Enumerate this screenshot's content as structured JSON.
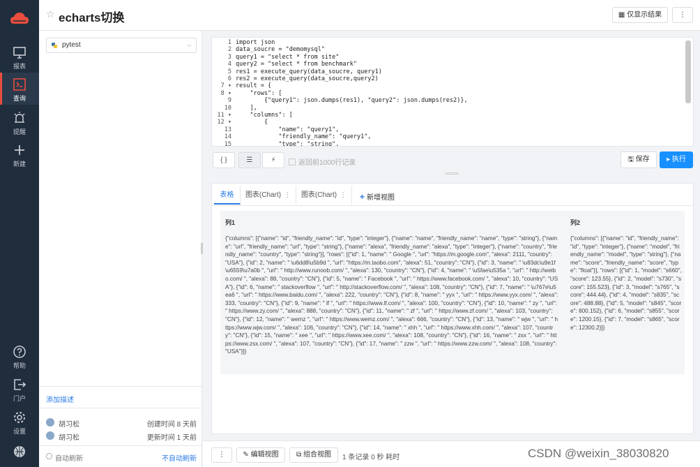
{
  "app": {
    "title": "echarts切换"
  },
  "nav": {
    "items": [
      {
        "label": "报表",
        "icon": "monitor-icon"
      },
      {
        "label": "查询",
        "icon": "terminal-icon"
      },
      {
        "label": "提醒",
        "icon": "alarm-icon"
      },
      {
        "label": "新建",
        "icon": "plus-icon"
      },
      {
        "label": "帮助",
        "icon": "help-icon"
      },
      {
        "label": "门户",
        "icon": "portal-icon"
      },
      {
        "label": "设置",
        "icon": "gear-icon"
      }
    ]
  },
  "header": {
    "results_only": "仅显示结果",
    "more": "⋮"
  },
  "datasource": {
    "selected": "pytest"
  },
  "left": {
    "add_desc": "添加描述",
    "created": {
      "user": "胡习松",
      "text": "创建时间 8 天前"
    },
    "updated": {
      "user": "胡习松",
      "text": "更新时间 1 天前"
    },
    "auto_refresh": "自动刷新",
    "no_auto_refresh": "不自动刷新"
  },
  "editor": {
    "lines": [
      {
        "n": "1",
        "code": "import json"
      },
      {
        "n": "2",
        "code": "data_soucre = \"demomysql\""
      },
      {
        "n": "3",
        "code": "query1 = \"select * from site\""
      },
      {
        "n": "4",
        "code": "query2 = \"select * from benchmark\""
      },
      {
        "n": "5",
        "code": "res1 = execute_query(data_soucre, query1)"
      },
      {
        "n": "6",
        "code": "res2 = execute_query(data_soucre,query2)"
      },
      {
        "n": "7 ▾",
        "code": "result = {"
      },
      {
        "n": "8 ▾",
        "code": "    \"rows\": ["
      },
      {
        "n": "9",
        "code": "        {\"query1\": json.dumps(res1), \"query2\": json.dumps(res2)},"
      },
      {
        "n": "10",
        "code": "    ],"
      },
      {
        "n": "11 ▾",
        "code": "    \"columns\": ["
      },
      {
        "n": "12 ▾",
        "code": "        {"
      },
      {
        "n": "13",
        "code": "            \"name\": \"query1\","
      },
      {
        "n": "14",
        "code": "            \"friendly_name\": \"query1\","
      },
      {
        "n": "15",
        "code": "            \"type\": \"string\","
      }
    ],
    "format_label": "{ }",
    "limit_label": "返回前1000行记录",
    "save_label": "保存",
    "run_label": "▸ 执行"
  },
  "results": {
    "tabs": [
      {
        "label": "表格"
      },
      {
        "label": "图表(Chart)"
      },
      {
        "label": "图表(Chart)"
      }
    ],
    "add_view": "新增视图",
    "columns": [
      "列1",
      "列2"
    ],
    "row": [
      "{\"columns\": [{\"name\": \"id\", \"friendly_name\": \"id\", \"type\": \"integer\"}, {\"name\": \"name\", \"friendly_name\": \"name\", \"type\": \"string\"}, {\"name\": \"url\", \"friendly_name\": \"url\", \"type\": \"string\"}, {\"name\": \"alexa\", \"friendly_name\": \"alexa\", \"type\": \"integer\"}, {\"name\": \"country\", \"friendly_name\": \"country\", \"type\": \"string\"}], \"rows\": [{\"id\": 1, \"name\": \" Google \", \"url\": \"https://m.google.com\", \"alexa\": 2111, \"country\": \"USA\"}, {\"id\": 2, \"name\": \" \\u6dd8\\u5b9d \", \"url\": \"https://m.taobo.com\", \"alexa\": 51, \"country\": \"CN\"}, {\"id\": 3, \"name\": \" \\u83dc\\u9e1f\\u6559\\u7a0b \", \"url\": \" http://www.runoob.com/ \", \"alexa\": 130, \"country\": \"CN\"}, {\"id\": 4, \"name\": \" \\u5fae\\u535a \", \"url\": \" http://weibo.com/ \", \"alexa\": 88, \"country\": \"CN\"}, {\"id\": 5, \"name\": \" Facebook \", \"url\": \" https://www.facebook.com/ \", \"alexa\": 10, \"country\": \"USA\"}, {\"id\": 6, \"name\": \" stackoverflow \", \"url\": \" http://stackoverflow.com/ \", \"alexa\": 108, \"country\": \"CN\"}, {\"id\": 7, \"name\": \" \\u767e\\u5ea6 \", \"url\": \" https://www.baidu.com/ \", \"alexa\": 222, \"country\": \"CN\"}, {\"id\": 8, \"name\": \" yyx \", \"url\": \" https://www.yyx.com/ \", \"alexa\": 333, \"country\": \"CN\"}, {\"id\": 9, \"name\": \" lf \", \"url\": \" https://www.lf.com/ \", \"alexa\": 100, \"country\": \"CN\"}, {\"id\": 10, \"name\": \" zy \", \"url\": \" https://www.zy.com/ \", \"alexa\": 888, \"country\": \"CN\"}, {\"id\": 11, \"name\": \" zf \", \"url\": \" https://www.zf.com/ \", \"alexa\": 103, \"country\": \"CN\"}, {\"id\": 12, \"name\": \" wemz \", \"url\": \" https://www.wemz.com/ \", \"alexa\": 666, \"country\": \"CN\"}, {\"id\": 13, \"name\": \" wjw \", \"url\": \" https://www.wjw.com/ \", \"alexa\": 106, \"country\": \"CN\"}, {\"id\": 14, \"name\": \" xhh \", \"url\": \" https://www.xhh.com/ \", \"alexa\": 107, \"country\": \"CN\"}, {\"id\": 15, \"name\": \" xee \", \"url\": \" https://www.xee.com/ \", \"alexa\": 108, \"country\": \"CN\"}, {\"id\": 16, \"name\": \" zsx \", \"url\": \" https://www.zsx.com/ \", \"alexa\": 107, \"country\": \"CN\"}, {\"id\": 17, \"name\": \" zzw \", \"url\": \" https://www.zzw.com/ \", \"alexa\": 108, \"country\": \"USA\"}]}",
      "{\"columns\": [{\"name\": \"id\", \"friendly_name\": \"id\", \"type\": \"integer\"}, {\"name\": \"model\", \"friendly_name\": \"model\", \"type\": \"string\"}, {\"name\": \"score\", \"friendly_name\": \"score\", \"type\": \"float\"}], \"rows\": [{\"id\": 1, \"model\": \"s660\", \"score\": 123.55}, {\"id\": 2, \"model\": \"s730\", \"score\": 155.523}, {\"id\": 3, \"model\": \"s765\", \"score\": 444.44}, {\"id\": 4, \"model\": \"s835\", \"score\": 488.88}, {\"id\": 5, \"model\": \"s845\", \"score\": 800.152}, {\"id\": 6, \"model\": \"s855\", \"score\": 1200.15}, {\"id\": 7, \"model\": \"s865\", \"score\": 12300.2}]}"
    ]
  },
  "bottom": {
    "more": "⋮",
    "edit_view": "编辑视图",
    "combine_view": "组合视图",
    "status": "1 条记录 0 秒 耗时",
    "watermark": "CSDN @weixin_38030820"
  },
  "colors": {
    "nav_bg": "#1f2d3d",
    "accent": "#1890ff",
    "active_marker": "#e84d3d"
  }
}
